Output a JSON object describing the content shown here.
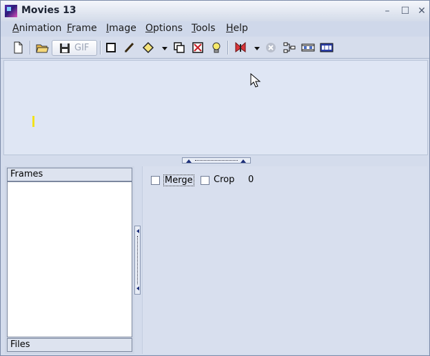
{
  "window": {
    "title": "Movies 13",
    "controls": {
      "minimize": "–",
      "maximize": "☐",
      "close": "✕"
    }
  },
  "menu": [
    {
      "mnemonic": "A",
      "rest": "nimation"
    },
    {
      "mnemonic": "F",
      "rest": "rame"
    },
    {
      "mnemonic": "I",
      "rest": "mage"
    },
    {
      "mnemonic": "O",
      "rest": "ptions"
    },
    {
      "mnemonic": "T",
      "rest": "ools"
    },
    {
      "mnemonic": "H",
      "rest": "elp"
    }
  ],
  "toolbar": {
    "gif_label": "GIF",
    "icons": [
      "new-document-icon",
      "open-folder-icon",
      "save-disk-icon",
      "rectangle-icon",
      "pencil-icon",
      "diamond-icon",
      "dropdown-arrow-icon",
      "duplicate-frames-icon",
      "delete-frame-icon",
      "lightbulb-icon",
      "butterfly-icon",
      "dropdown-arrow-icon",
      "stop-disabled-icon",
      "tree-icon",
      "film-strip-icon",
      "film-strip-blue-icon"
    ]
  },
  "panels": {
    "frames_header": "Frames",
    "files_header": "Files"
  },
  "options": {
    "merge_label": "Merge",
    "crop_label": "Crop",
    "counter": "0"
  },
  "colors": {
    "canvas_bg": "#dfe6f4",
    "window_bg": "#d4dcec",
    "accent_yellow": "#f2e21a"
  }
}
